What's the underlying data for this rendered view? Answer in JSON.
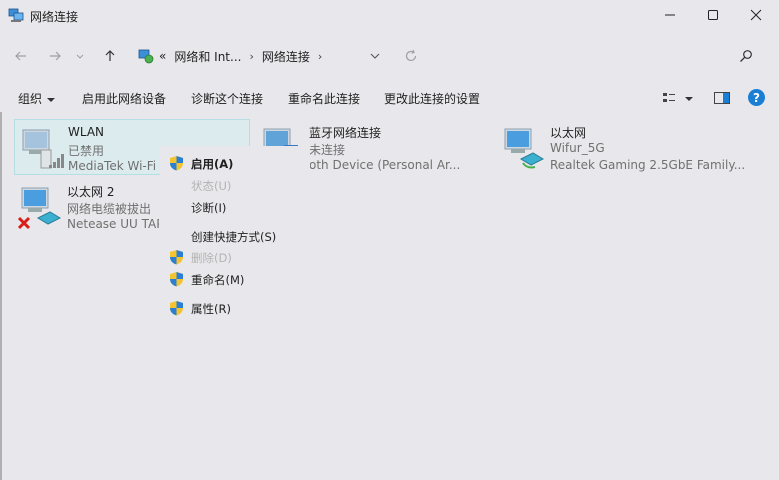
{
  "window": {
    "title": "网络连接"
  },
  "address": {
    "chevrons": "«",
    "crumbs": [
      "网络和 Int...",
      "网络连接"
    ],
    "sep": "›"
  },
  "commands": {
    "organize": "组织",
    "enable_device": "启用此网络设备",
    "diagnose": "诊断这个连接",
    "rename": "重命名此连接",
    "change_settings": "更改此连接的设置"
  },
  "help": "?",
  "connections": [
    {
      "name": "WLAN",
      "status": "已禁用",
      "device": "MediaTek Wi-Fi",
      "selected": true
    },
    {
      "name": "蓝牙网络连接",
      "status": "未连接",
      "device": "oth Device (Personal Ar..."
    },
    {
      "name": "以太网",
      "status": "Wifur_5G",
      "device": "Realtek Gaming 2.5GbE Family..."
    },
    {
      "name": "以太网 2",
      "status": "网络电缆被拔出",
      "device": "Netease UU TAP"
    }
  ],
  "context_menu": {
    "enable": "启用(A)",
    "status": "状态(U)",
    "diagnose": "诊断(I)",
    "create_shortcut": "创建快捷方式(S)",
    "delete": "删除(D)",
    "rename": "重命名(M)",
    "properties": "属性(R)"
  },
  "colors": {
    "background": "#e8e8ec",
    "selection": "#dcebee",
    "accent": "#1a7fd4",
    "disabled_text": "#b3b3b3",
    "error_x": "#d91e18"
  }
}
